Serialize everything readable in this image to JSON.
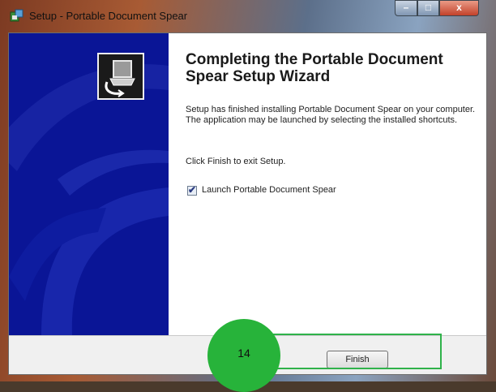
{
  "window": {
    "title": "Setup - Portable Document Spear",
    "controls": {
      "minimize": "–",
      "maximize": "□",
      "close": "x"
    }
  },
  "wizard": {
    "heading": "Completing the Portable Document Spear Setup Wizard",
    "body": "Setup has finished installing Portable Document Spear on your computer. The application may be launched by selecting the installed shortcuts.",
    "exit_text": "Click Finish to exit Setup.",
    "launch_checkbox": {
      "label": "Launch Portable Document Spear",
      "checked": true,
      "mark": "✔"
    }
  },
  "footer": {
    "finish_label": "Finish"
  },
  "annotation": {
    "step_number": "14"
  },
  "colors": {
    "side_panel": "#0a1596",
    "annotation_green": "#27b33a"
  }
}
